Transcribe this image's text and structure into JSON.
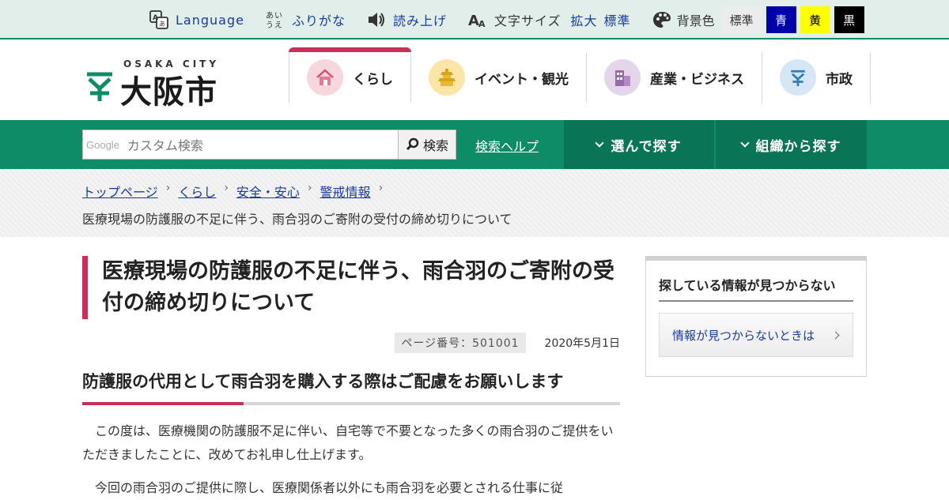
{
  "utility": {
    "language": "Language",
    "furigana": "ふりがな",
    "read_aloud": "読み上げ",
    "font_size_label": "文字サイズ",
    "font_size_options": [
      "拡大",
      "標準"
    ],
    "bg_label": "背景色",
    "bg_options": [
      "標準",
      "青",
      "黄",
      "黒"
    ]
  },
  "logo": {
    "sub": "OSAKA CITY",
    "name": "大阪市"
  },
  "gnav": [
    {
      "label": "くらし",
      "icon": "house-icon",
      "color": "#f7d7dd"
    },
    {
      "label": "イベント・観光",
      "icon": "castle-icon",
      "color": "#fbe6a8"
    },
    {
      "label": "産業・ビジネス",
      "icon": "building-icon",
      "color": "#e4d6ea"
    },
    {
      "label": "市政",
      "icon": "city-emblem-icon",
      "color": "#d6e6f5"
    }
  ],
  "search": {
    "google_mark": "Google",
    "placeholder": "カスタム検索",
    "button": "検索",
    "help": "検索ヘルプ",
    "find_select": "選んで探す",
    "find_org": "組織から探す"
  },
  "breadcrumb": {
    "items": [
      "トップページ",
      "くらし",
      "安全・安心",
      "警戒情報"
    ],
    "current": "医療現場の防護服の不足に伴う、雨合羽のご寄附の受付の締め切りについて"
  },
  "article": {
    "title": "医療現場の防護服の不足に伴う、雨合羽のご寄附の受付の締め切りについて",
    "page_number": "ページ番号：501001",
    "date": "2020年5月1日",
    "heading": "防護服の代用として雨合羽を購入する際はご配慮をお願いします",
    "para1": "この度は、医療機関の防護服不足に伴い、自宅等で不要となった多くの雨合羽のご提供をいただきましたことに、改めてお礼申し仕上げます。",
    "para2": "今回の雨合羽のご提供に際し、医療関係者以外にも雨合羽を必要とされる仕事に従"
  },
  "sidebar": {
    "title": "探している情報が見つからない",
    "link": "情報が見つからないときは"
  },
  "colors": {
    "brand_green": "#0e8c67",
    "accent_pink": "#c8305a",
    "link_blue": "#1a3aa0"
  }
}
